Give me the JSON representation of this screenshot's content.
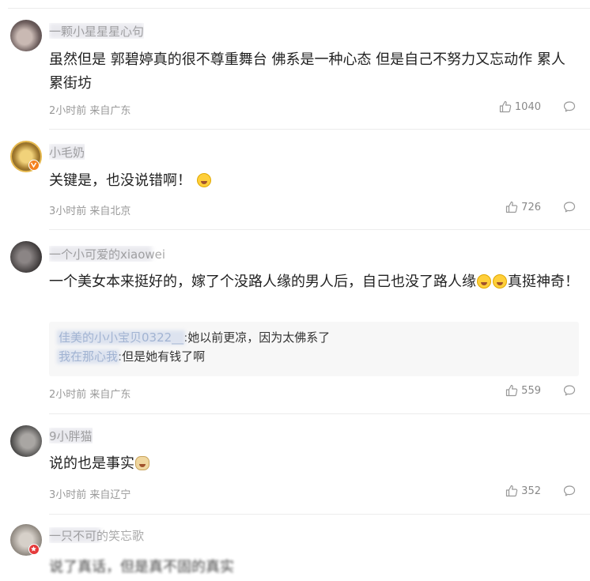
{
  "comments": [
    {
      "username": "一颗小星星星心句",
      "content": "虽然但是 郭碧婷真的很不尊重舞台 佛系是一种心态 但是自己不努力又忘动作 累人累街坊",
      "time": "2小时前",
      "location": "来自广东",
      "likes": "1040"
    },
    {
      "username": "小毛奶",
      "content": "关键是，也没说错啊！",
      "emoji": "laugh-cry-emoji",
      "time": "3小时前",
      "location": "来自北京",
      "likes": "726"
    },
    {
      "username": "一个小可爱的xiaowei",
      "content_part1": "一个美女本来挺好的，嫁了个没路人缘的男人后，自己也没了路人缘",
      "content_part2": "真挺神奇！",
      "replies": [
        {
          "name": "佳美的小小宝贝0322__",
          "text": ":她以前更凉，因为太佛系了"
        },
        {
          "name": "我在那心我",
          "text": ":但是她有钱了啊"
        }
      ],
      "time": "2小时前",
      "location": "来自广东",
      "likes": "559"
    },
    {
      "username": "9小胖猫",
      "content": "说的也是事实",
      "emoji": "doge-emoji",
      "time": "3小时前",
      "location": "来自辽宁",
      "likes": "352"
    },
    {
      "username": "一只不可的笑忘歌",
      "content": "说了真话，但是真不固的真实",
      "time": "",
      "location": "",
      "likes": ""
    }
  ],
  "colors": {
    "meta": "#999999",
    "divider": "#ececec",
    "reply_bg": "#f7f7f7",
    "verified_orange": "#f5811f",
    "verified_red": "#e5393a"
  }
}
